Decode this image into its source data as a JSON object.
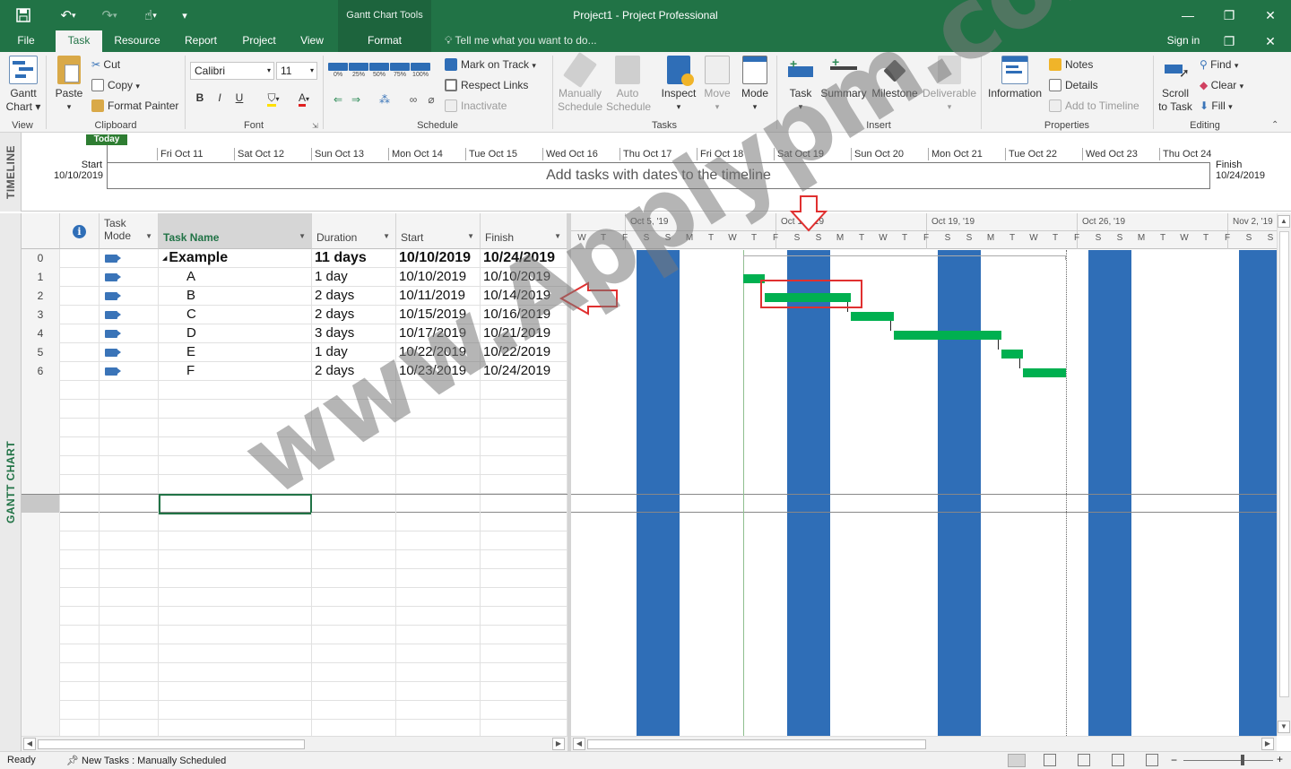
{
  "titlebar": {
    "context_group": "Gantt Chart Tools",
    "title": "Project1 - Project Professional",
    "qat": {
      "save_icon": "save-icon",
      "undo_icon": "undo-icon",
      "redo_icon": "redo-icon",
      "touch_icon": "touch-mode-icon",
      "customize_icon": "customize-icon"
    }
  },
  "tabs": [
    {
      "label": "File"
    },
    {
      "label": "Task"
    },
    {
      "label": "Resource"
    },
    {
      "label": "Report"
    },
    {
      "label": "Project"
    },
    {
      "label": "View"
    },
    {
      "label": "Format"
    }
  ],
  "tell_me": "Tell me what you want to do...",
  "sign_in": "Sign in",
  "ribbon": {
    "view": {
      "gantt_label_1": "Gantt",
      "gantt_label_2": "Chart ▾",
      "group": "View"
    },
    "clipboard": {
      "paste": "Paste",
      "cut": "Cut",
      "copy": "Copy",
      "format_painter": "Format Painter",
      "group": "Clipboard"
    },
    "font": {
      "family": "Calibri",
      "size": "11",
      "bold": "B",
      "italic": "I",
      "underline": "U",
      "group": "Font"
    },
    "schedule": {
      "pct": [
        "0%",
        "25%",
        "50%",
        "75%",
        "100%"
      ],
      "mark_on_track": "Mark on Track",
      "respect_links": "Respect Links",
      "inactivate": "Inactivate",
      "group": "Schedule"
    },
    "tasks": {
      "manually_1": "Manually",
      "manually_2": "Schedule",
      "auto_1": "Auto",
      "auto_2": "Schedule",
      "inspect": "Inspect",
      "move": "Move",
      "mode": "Mode",
      "group": "Tasks"
    },
    "insert": {
      "task": "Task",
      "summary": "Summary",
      "milestone": "Milestone",
      "deliverable": "Deliverable",
      "group": "Insert"
    },
    "properties": {
      "information": "Information",
      "notes": "Notes",
      "details": "Details",
      "add_to_timeline": "Add to Timeline",
      "group": "Properties"
    },
    "editing": {
      "scroll_1": "Scroll",
      "scroll_2": "to Task",
      "find": "Find",
      "clear": "Clear",
      "fill": "Fill",
      "group": "Editing"
    }
  },
  "timeline": {
    "side_label": "TIMELINE",
    "today": "Today",
    "start_label": "Start",
    "start_date": "10/10/2019",
    "finish_label": "Finish",
    "finish_date": "10/24/2019",
    "days": [
      "Fri Oct 11",
      "Sat Oct 12",
      "Sun Oct 13",
      "Mon Oct 14",
      "Tue Oct 15",
      "Wed Oct 16",
      "Thu Oct 17",
      "Fri Oct 18",
      "Sat Oct 19",
      "Sun Oct 20",
      "Mon Oct 21",
      "Tue Oct 22",
      "Wed Oct 23",
      "Thu Oct 24"
    ],
    "placeholder": "Add tasks with dates to the timeline"
  },
  "gantt": {
    "side_label": "GANTT CHART",
    "columns": {
      "info_icon": "info-icon",
      "task_mode_1": "Task",
      "task_mode_2": "Mode",
      "task_name": "Task Name",
      "duration": "Duration",
      "start": "Start",
      "finish": "Finish"
    },
    "rows": [
      {
        "id": "0",
        "name": "Example",
        "duration": "11 days",
        "start": "10/10/2019",
        "finish": "10/24/2019",
        "summary": true
      },
      {
        "id": "1",
        "name": "A",
        "duration": "1 day",
        "start": "10/10/2019",
        "finish": "10/10/2019"
      },
      {
        "id": "2",
        "name": "B",
        "duration": "2 days",
        "start": "10/11/2019",
        "finish": "10/14/2019"
      },
      {
        "id": "3",
        "name": "C",
        "duration": "2 days",
        "start": "10/15/2019",
        "finish": "10/16/2019"
      },
      {
        "id": "4",
        "name": "D",
        "duration": "3 days",
        "start": "10/17/2019",
        "finish": "10/21/2019"
      },
      {
        "id": "5",
        "name": "E",
        "duration": "1 day",
        "start": "10/22/2019",
        "finish": "10/22/2019"
      },
      {
        "id": "6",
        "name": "F",
        "duration": "2 days",
        "start": "10/23/2019",
        "finish": "10/24/2019"
      }
    ],
    "weeks": [
      "Oct 5, '19",
      "Oct 12, '19",
      "Oct 19, '19",
      "Oct 26, '19",
      "Nov 2, '19"
    ],
    "day_letters": [
      "W",
      "T",
      "F",
      "S",
      "S",
      "M",
      "T",
      "W",
      "T",
      "F",
      "S",
      "S",
      "M",
      "T",
      "W",
      "T",
      "F",
      "S",
      "S",
      "M",
      "T",
      "W",
      "T",
      "F",
      "S",
      "S",
      "M",
      "T",
      "W",
      "T",
      "F",
      "S",
      "S"
    ]
  },
  "watermark": "www.Applypm.com",
  "status": {
    "ready": "Ready",
    "new_tasks": "New Tasks : Manually Scheduled"
  },
  "colors": {
    "brand": "#217346",
    "nonworking": "#2f6eb7",
    "bar": "#00b050",
    "annotation": "#e03030"
  }
}
